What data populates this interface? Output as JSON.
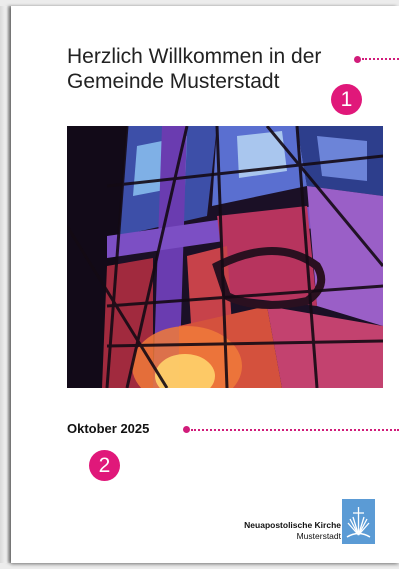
{
  "title": "Herzlich Willkommen in der Gemeinde Musterstadt",
  "date": "Oktober 2025",
  "markers": [
    "1",
    "2"
  ],
  "brand": {
    "org": "Neuapostolische Kirche",
    "location": "Musterstadt"
  },
  "colors": {
    "accent": "#e0187a",
    "logo_blue": "#5b9bd5"
  },
  "photo": {
    "description_icon": "stained-glass-window"
  }
}
